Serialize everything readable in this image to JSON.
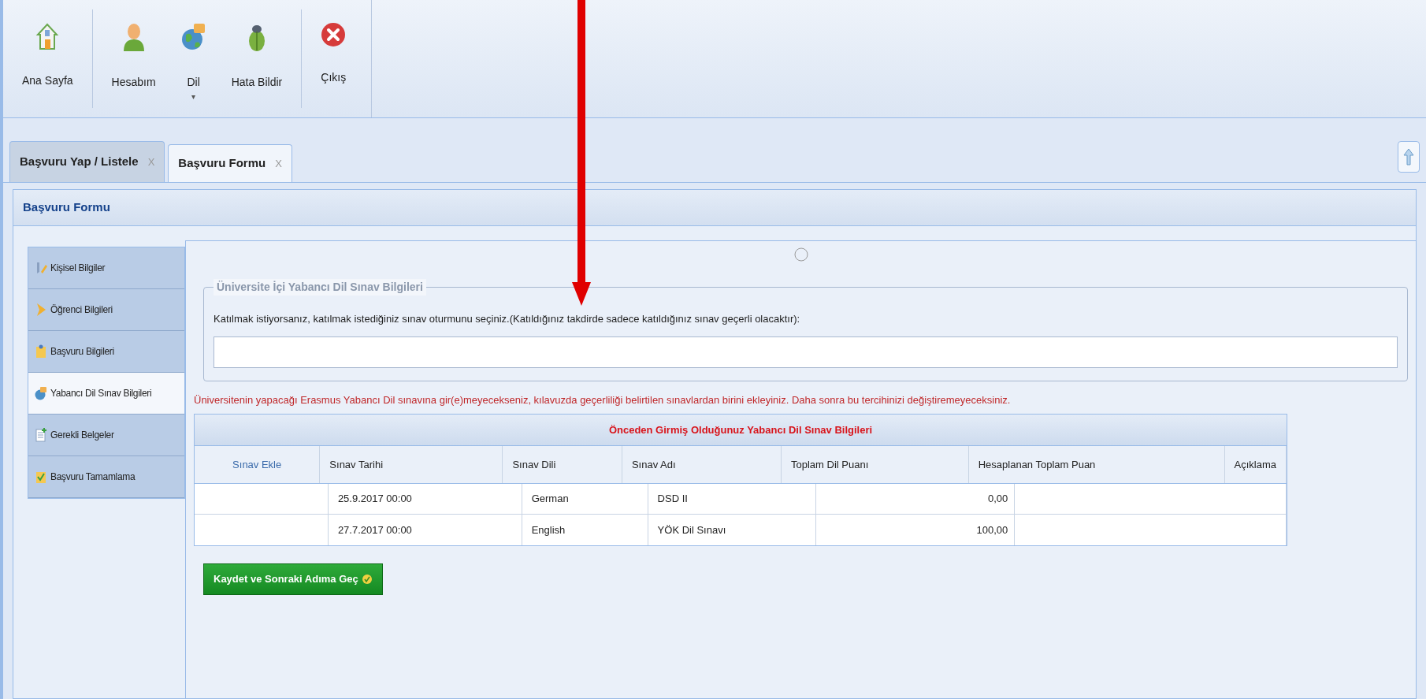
{
  "toolbar": {
    "items": [
      {
        "label": "Ana Sayfa",
        "kind": "home"
      },
      {
        "label": "Hesabım",
        "kind": "user"
      },
      {
        "label": "Dil",
        "kind": "globe",
        "caret": "▾"
      },
      {
        "label": "Hata Bildir",
        "kind": "bug"
      },
      {
        "label": "Çıkış",
        "kind": "exit"
      }
    ]
  },
  "tabs": [
    {
      "label": "Başvuru Yap / Listele",
      "close": "X",
      "selected": false
    },
    {
      "label": "Başvuru Formu",
      "close": "X",
      "selected": true
    }
  ],
  "panel": {
    "title": "Başvuru Formu"
  },
  "sidebar": {
    "items": [
      {
        "label": "Kişisel Bilgiler",
        "kind": "pencil",
        "selected": false
      },
      {
        "label": "Öğrenci Bilgileri",
        "kind": "arrow",
        "selected": false
      },
      {
        "label": "Başvuru Bilgileri",
        "kind": "clipboard",
        "selected": false
      },
      {
        "label": "Yabancı Dil Sınav Bilgileri",
        "kind": "globe",
        "selected": true
      },
      {
        "label": "Gerekli Belgeler",
        "kind": "document",
        "selected": false
      },
      {
        "label": "Başvuru Tamamlama",
        "kind": "check",
        "selected": false
      }
    ]
  },
  "fieldset": {
    "legend": "Üniversite İçi Yabancı Dil Sınav Bilgileri",
    "prompt": "Katılmak istiyorsanız, katılmak istediğiniz sınav oturmunu seçiniz.(Katıldığınız takdirde sadece katıldığınız sınav geçerli olacaktır):"
  },
  "warning": "Üniversitenin yapacağı Erasmus Yabancı Dil sınavına gir(e)meyecekseniz, kılavuzda geçerliliği belirtilen sınavlardan birini ekleyiniz. Daha sonra bu tercihinizi değiştiremeyeceksiniz.",
  "table": {
    "title": "Önceden Girmiş Olduğunuz Yabancı Dil Sınav Bilgileri",
    "add_link": "Sınav Ekle",
    "columns": [
      "Sınav Tarihi",
      "Sınav Dili",
      "Sınav Adı",
      "Toplam Dil Puanı",
      "Hesaplanan Toplam Puan",
      "Açıklama"
    ],
    "rows": [
      {
        "date": "25.9.2017 00:00",
        "language": "German",
        "exam": "DSD II",
        "score": "0,00"
      },
      {
        "date": "27.7.2017 00:00",
        "language": "English",
        "exam": "YÖK Dil Sınavı",
        "score": "100,00"
      }
    ]
  },
  "save_button": "Kaydet ve Sonraki Adıma Geç"
}
